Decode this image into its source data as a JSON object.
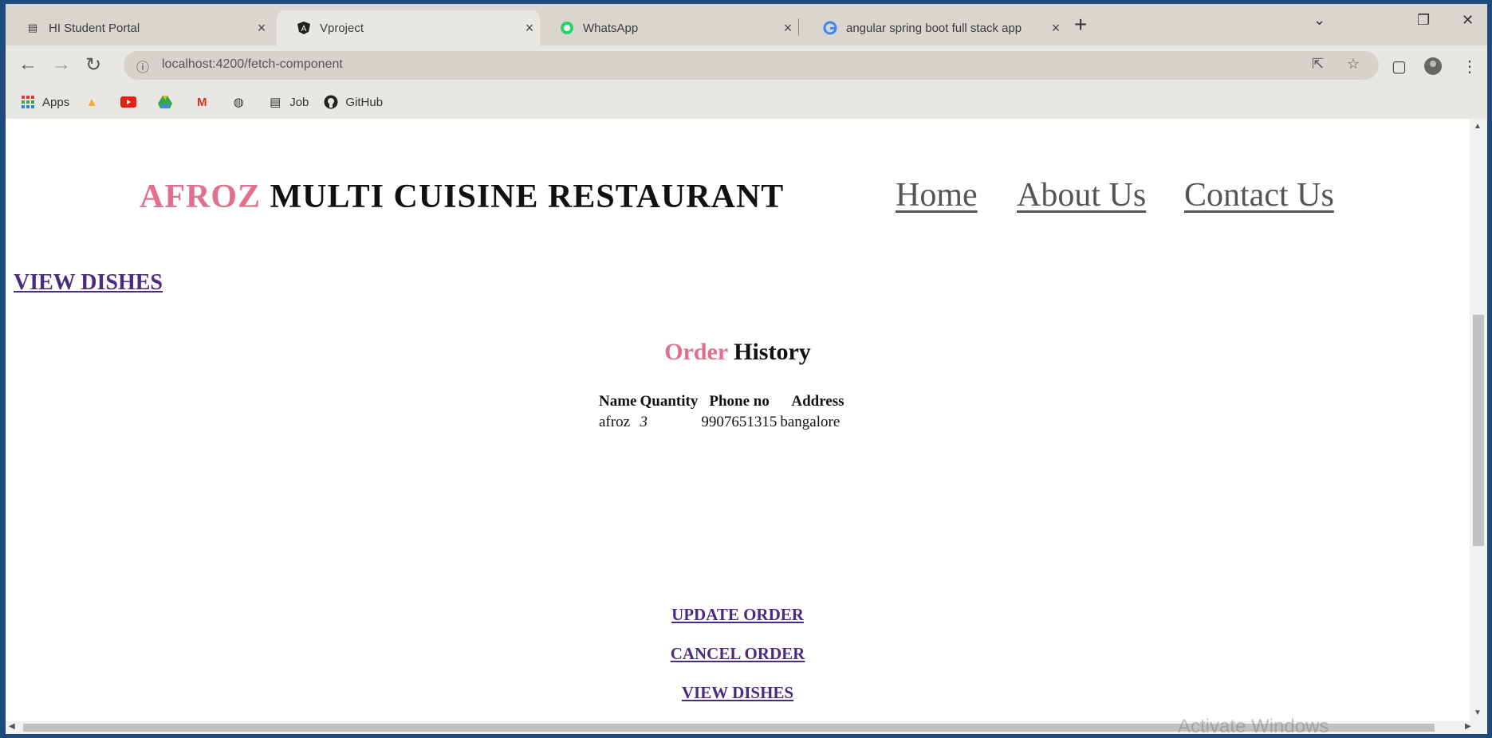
{
  "browser": {
    "tabs": [
      {
        "title": "HI Student Portal",
        "icon": "portal-icon"
      },
      {
        "title": "Vproject",
        "icon": "angular-icon"
      },
      {
        "title": "WhatsApp",
        "icon": "whatsapp-icon"
      },
      {
        "title": "angular spring boot full stack app",
        "icon": "google-icon"
      }
    ],
    "url": "localhost:4200/fetch-component",
    "bookmarks": [
      {
        "label": "Apps",
        "icon": "apps-grid-icon"
      },
      {
        "label": "",
        "icon": "drive-icon"
      },
      {
        "label": "",
        "icon": "youtube-icon"
      },
      {
        "label": "",
        "icon": "google-drive-icon"
      },
      {
        "label": "",
        "icon": "gmail-icon"
      },
      {
        "label": "",
        "icon": "globe-icon"
      },
      {
        "label": "Job",
        "icon": "job-icon"
      },
      {
        "label": "GitHub",
        "icon": "github-icon"
      }
    ]
  },
  "header": {
    "brand_accent": "AFROZ",
    "brand_rest": " MULTI CUISINE RESTAURANT",
    "nav": {
      "home": "Home",
      "about": "About Us",
      "contact": "Contact Us"
    }
  },
  "main": {
    "view_dishes_top": "VIEW DISHES",
    "title_accent": "Order",
    "title_rest": " History",
    "table": {
      "headers": [
        "Name",
        "Quantity",
        "Phone no",
        "Address"
      ],
      "rows": [
        [
          "afroz",
          "3",
          "9907651315",
          "bangalore"
        ]
      ]
    },
    "actions": {
      "update": "UPDATE ORDER",
      "cancel": "CANCEL ORDER",
      "view": "VIEW DISHES"
    }
  },
  "watermark": "Activate Windows",
  "colors": {
    "accent": "#e0708b",
    "link": "#4b2b7f",
    "taskbar": "#1e4a7d"
  }
}
